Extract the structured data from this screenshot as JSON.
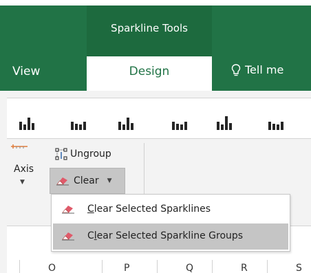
{
  "ribbon": {
    "contextual_group": "Sparkline Tools",
    "tabs": [
      {
        "label": "View",
        "active": false
      },
      {
        "label": "Design",
        "active": true
      }
    ],
    "tellme": {
      "icon": "lightbulb-icon",
      "label": "Tell me"
    }
  },
  "colors": {
    "ribbon_green": "#217346",
    "context_green": "#1d6a3e",
    "hover_gray": "#c5c5c5",
    "eraser_pink": "#e05a6a"
  },
  "group_commands": {
    "axis": {
      "label": "Axis",
      "icon": "axis-icon"
    },
    "ungroup": {
      "label": "Ungroup",
      "icon": "ungroup-icon"
    },
    "clear": {
      "label": "Clear",
      "icon": "eraser-icon"
    }
  },
  "clear_menu": {
    "items": [
      {
        "pre": "",
        "accel": "C",
        "post": "lear Selected Sparklines",
        "highlighted": false
      },
      {
        "pre": "C",
        "accel": "l",
        "post": "ear Selected Sparkline Groups",
        "highlighted": true
      }
    ]
  },
  "column_headers": [
    "O",
    "P",
    "Q",
    "R",
    "S"
  ]
}
